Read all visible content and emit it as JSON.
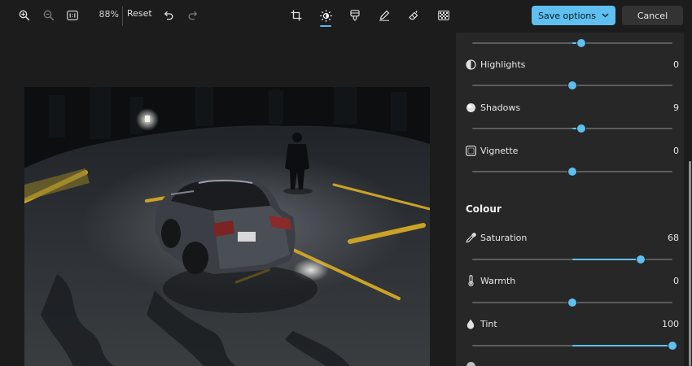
{
  "toolbar": {
    "zoom_percent": "88%",
    "reset_label": "Reset",
    "save_label": "Save options",
    "cancel_label": "Cancel",
    "accent_color": "#5ebff0",
    "active_tool": "adjust",
    "icons": [
      "zoom-in-icon",
      "zoom-out-icon",
      "actual-size-icon",
      "undo-icon",
      "redo-icon",
      "crop-icon",
      "adjust-icon",
      "filter-icon",
      "markup-icon",
      "erase-icon",
      "background-icon",
      "chevron-down-icon"
    ]
  },
  "adjustments": {
    "top_slider": {
      "value": 9,
      "min": -100,
      "max": 100
    },
    "highlights": {
      "label": "Highlights",
      "value": "0",
      "num": 0,
      "min": -100,
      "max": 100,
      "icon": "highlights-icon"
    },
    "shadows": {
      "label": "Shadows",
      "value": "9",
      "num": 9,
      "min": -100,
      "max": 100,
      "icon": "shadows-icon"
    },
    "vignette": {
      "label": "Vignette",
      "value": "0",
      "num": 0,
      "min": -100,
      "max": 100,
      "icon": "vignette-icon"
    }
  },
  "colour": {
    "section_title": "Colour",
    "saturation": {
      "label": "Saturation",
      "value": "68",
      "num": 68,
      "min": -100,
      "max": 100,
      "icon": "eyedropper-icon"
    },
    "warmth": {
      "label": "Warmth",
      "value": "0",
      "num": 0,
      "min": -100,
      "max": 100,
      "icon": "thermometer-icon"
    },
    "tint": {
      "label": "Tint",
      "value": "100",
      "num": 100,
      "min": -100,
      "max": 100,
      "icon": "droplet-icon"
    }
  }
}
